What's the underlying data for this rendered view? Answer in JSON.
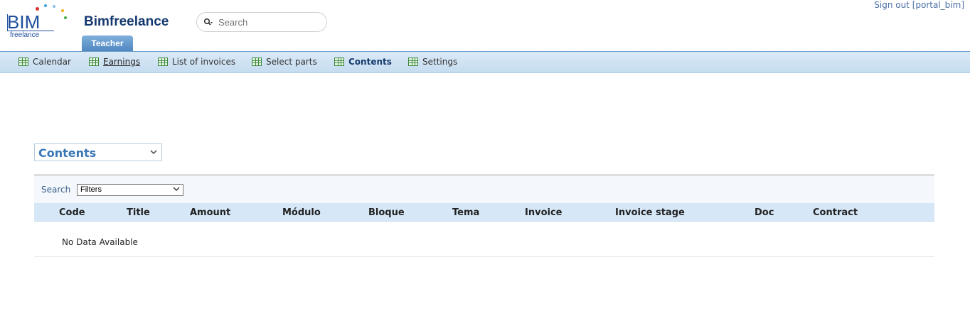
{
  "header": {
    "logo_main": "BIM",
    "logo_sub": "freelance",
    "app_title": "Bimfreelance",
    "search_placeholder": "Search",
    "signout": "Sign out [portal_bim]",
    "role_tab": "Teacher"
  },
  "nav": {
    "items": [
      {
        "label": "Calendar"
      },
      {
        "label": "Earnings"
      },
      {
        "label": "List of invoices"
      },
      {
        "label": "Select parts"
      },
      {
        "label": "Contents"
      },
      {
        "label": "Settings"
      }
    ]
  },
  "content": {
    "selector_label": "Contents",
    "search_label": "Search",
    "filter_value": "Filters",
    "columns": [
      "Code",
      "Title",
      "Amount",
      "Módulo",
      "Bloque",
      "Tema",
      "Invoice",
      "Invoice stage",
      "Doc",
      "Contract"
    ],
    "empty_message": "No Data Available"
  },
  "colors": {
    "brand": "#15396e",
    "nav_bg": "#c5dcf0",
    "table_header_bg": "#d6e8f8",
    "accent": "#3a78b8"
  },
  "icons": {
    "search": "magnifier-icon",
    "nav": "grid-icon",
    "dropdown": "chevron-down-icon"
  }
}
